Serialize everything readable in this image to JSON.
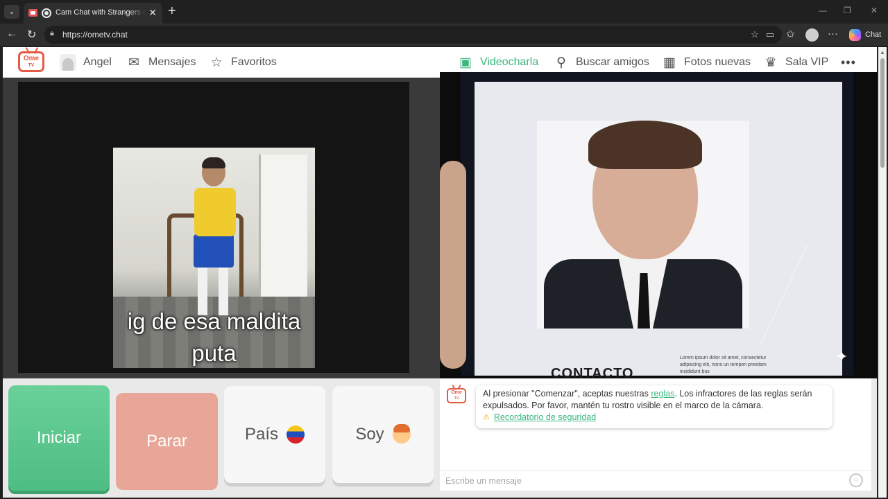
{
  "browser": {
    "tab_title": "Cam Chat with Strangers on O",
    "url": "https://ometv.chat",
    "chat_button_label": "Chat"
  },
  "logo": {
    "line1": "Ome",
    "line2": "TV"
  },
  "nav": {
    "user_name": "Angel",
    "messages": "Mensajes",
    "favorites": "Favoritos",
    "video_chat": "Videocharla",
    "find_friends": "Buscar amigos",
    "new_photos": "Fotos nuevas",
    "vip_room": "Sala VIP"
  },
  "left_video": {
    "caption_line1": "ig de esa maldita",
    "caption_line2": "puta"
  },
  "right_video": {
    "contact_heading": "CONTACTO",
    "small_text": "Lorem ipsum dolor sit amet, consectetur adipiscing elit, nons un tempori prexitarx incididunt bus"
  },
  "controls": {
    "start": "Iniciar",
    "stop": "Parar",
    "country": "País",
    "country_flag": "venezuela-flag",
    "gender": "Soy",
    "gender_icon": "boy-face-icon"
  },
  "chat": {
    "notice_before_link": "Al presionar \"Comenzar\", aceptas nuestras ",
    "rules_link": "reglas",
    "notice_after_link": ". Los infractores de las reglas serán expulsados. Por favor, mantén tu rostro visible en el marco de la cámara.",
    "safety_link": "Recordatorio de seguridad",
    "input_placeholder": "Escribe un mensaje"
  },
  "colors": {
    "accent_green": "#3ab77d",
    "start_button": "#5cc78e",
    "stop_button": "#e8a698",
    "logo_red": "#e55a45"
  }
}
